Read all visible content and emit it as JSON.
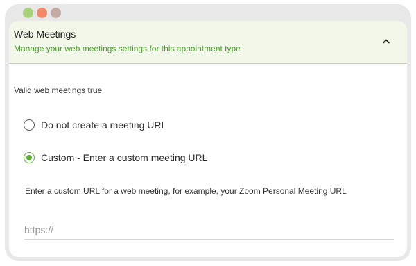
{
  "window": {
    "traffic_lights": [
      {
        "name": "green-dot",
        "color": "#a8d27a"
      },
      {
        "name": "red-dot",
        "color": "#f2876a"
      },
      {
        "name": "taupe-dot",
        "color": "#c4aba6"
      }
    ]
  },
  "section": {
    "title": "Web Meetings",
    "subtitle": "Manage your web meetings settings for this appointment type",
    "collapse_icon": "chevron-up-icon",
    "accent_color": "#4d9a2c",
    "header_bg": "#f1f7e9"
  },
  "status_text": "Valid web meetings true",
  "options": [
    {
      "label": "Do not create a meeting URL",
      "checked": false
    },
    {
      "label": "Custom - Enter a custom meeting URL",
      "checked": true
    }
  ],
  "custom_url": {
    "help": "Enter a custom URL for a web meeting, for example, your Zoom Personal Meeting URL",
    "placeholder": "https://",
    "value": ""
  }
}
